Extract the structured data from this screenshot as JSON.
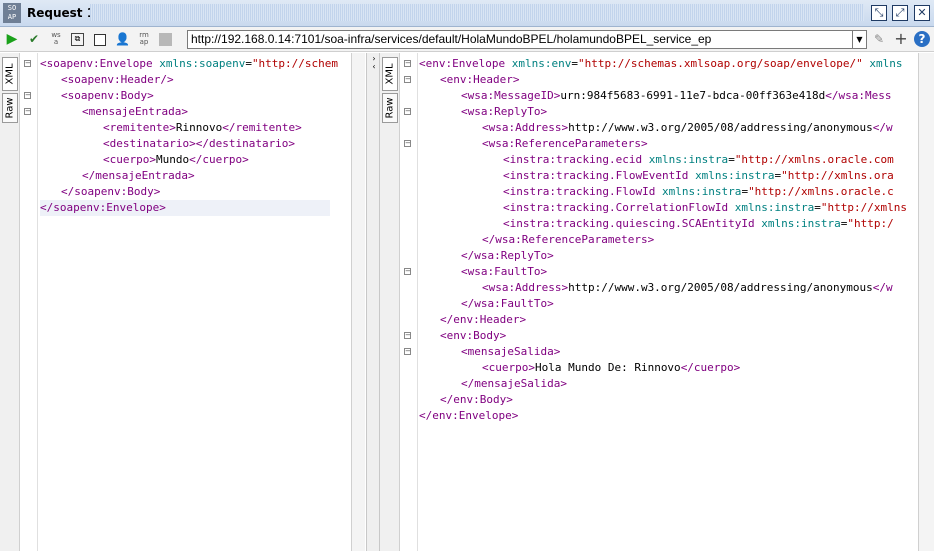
{
  "window": {
    "badge_top": "SO",
    "badge_bottom": "AP",
    "title": "Request 1",
    "controls": [
      "restore-icon",
      "maximize-icon",
      "close-icon"
    ]
  },
  "toolbar": {
    "url": "http://192.168.0.14:7101/soa-infra/services/default/HolaMundoBPEL/holamundoBPEL_service_ep",
    "icons": [
      "play-icon",
      "check-icon",
      "wsa-icon",
      "frame-icon",
      "checkbox-icon",
      "user-icon",
      "wsrm-icon",
      "stop-icon",
      "pin-icon",
      "plus-icon",
      "help-icon"
    ]
  },
  "request": {
    "tabs": [
      "XML",
      "Raw"
    ],
    "lines": [
      {
        "indent": 0,
        "fold": "-",
        "parts": [
          [
            "tag",
            "<soapenv:Envelope "
          ],
          [
            "attr",
            "xmlns:soapenv"
          ],
          [
            "txt",
            "="
          ],
          [
            "val",
            "\"http://schem"
          ]
        ]
      },
      {
        "indent": 1,
        "fold": "",
        "parts": [
          [
            "tag",
            "<soapenv:Header/>"
          ]
        ]
      },
      {
        "indent": 1,
        "fold": "-",
        "parts": [
          [
            "tag",
            "<soapenv:Body>"
          ]
        ]
      },
      {
        "indent": 2,
        "fold": "-",
        "parts": [
          [
            "tag",
            "<mensajeEntrada>"
          ]
        ]
      },
      {
        "indent": 3,
        "fold": "",
        "parts": [
          [
            "tag",
            "<remitente>"
          ],
          [
            "txt",
            "Rinnovo"
          ],
          [
            "tag",
            "</remitente>"
          ]
        ]
      },
      {
        "indent": 3,
        "fold": "",
        "parts": [
          [
            "tag",
            "<destinatario></destinatario>"
          ]
        ]
      },
      {
        "indent": 3,
        "fold": "",
        "parts": [
          [
            "tag",
            "<cuerpo>"
          ],
          [
            "txt",
            "Mundo"
          ],
          [
            "tag",
            "</cuerpo>"
          ]
        ]
      },
      {
        "indent": 2,
        "fold": "",
        "parts": [
          [
            "tag",
            "</mensajeEntrada>"
          ]
        ]
      },
      {
        "indent": 1,
        "fold": "",
        "parts": [
          [
            "tag",
            "</soapenv:Body>"
          ]
        ]
      },
      {
        "indent": 0,
        "fold": "",
        "parts": [
          [
            "tag",
            "</soapenv:Envelope>"
          ]
        ]
      }
    ]
  },
  "response": {
    "tabs": [
      "XML",
      "Raw"
    ],
    "lines": [
      {
        "indent": 0,
        "fold": "-",
        "parts": [
          [
            "tag",
            "<env:Envelope "
          ],
          [
            "attr",
            "xmlns:env"
          ],
          [
            "txt",
            "="
          ],
          [
            "val",
            "\"http://schemas.xmlsoap.org/soap/envelope/\""
          ],
          [
            "attr",
            " xmlns"
          ]
        ]
      },
      {
        "indent": 1,
        "fold": "-",
        "parts": [
          [
            "tag",
            "<env:Header>"
          ]
        ]
      },
      {
        "indent": 2,
        "fold": "",
        "parts": [
          [
            "tag",
            "<wsa:MessageID>"
          ],
          [
            "txt",
            "urn:984f5683-6991-11e7-bdca-00ff363e418d"
          ],
          [
            "tag",
            "</wsa:Mess"
          ]
        ]
      },
      {
        "indent": 2,
        "fold": "-",
        "parts": [
          [
            "tag",
            "<wsa:ReplyTo>"
          ]
        ]
      },
      {
        "indent": 3,
        "fold": "",
        "parts": [
          [
            "tag",
            "<wsa:Address>"
          ],
          [
            "txt",
            "http://www.w3.org/2005/08/addressing/anonymous"
          ],
          [
            "tag",
            "</w"
          ]
        ]
      },
      {
        "indent": 3,
        "fold": "-",
        "parts": [
          [
            "tag",
            "<wsa:ReferenceParameters>"
          ]
        ]
      },
      {
        "indent": 4,
        "fold": "",
        "parts": [
          [
            "tag",
            "<instra:tracking.ecid "
          ],
          [
            "attr",
            "xmlns:instra"
          ],
          [
            "txt",
            "="
          ],
          [
            "val",
            "\"http://xmlns.oracle.com"
          ]
        ]
      },
      {
        "indent": 4,
        "fold": "",
        "parts": [
          [
            "tag",
            "<instra:tracking.FlowEventId "
          ],
          [
            "attr",
            "xmlns:instra"
          ],
          [
            "txt",
            "="
          ],
          [
            "val",
            "\"http://xmlns.ora"
          ]
        ]
      },
      {
        "indent": 4,
        "fold": "",
        "parts": [
          [
            "tag",
            "<instra:tracking.FlowId "
          ],
          [
            "attr",
            "xmlns:instra"
          ],
          [
            "txt",
            "="
          ],
          [
            "val",
            "\"http://xmlns.oracle.c"
          ]
        ]
      },
      {
        "indent": 4,
        "fold": "",
        "parts": [
          [
            "tag",
            "<instra:tracking.CorrelationFlowId "
          ],
          [
            "attr",
            "xmlns:instra"
          ],
          [
            "txt",
            "="
          ],
          [
            "val",
            "\"http://xmlns"
          ]
        ]
      },
      {
        "indent": 4,
        "fold": "",
        "parts": [
          [
            "tag",
            "<instra:tracking.quiescing.SCAEntityId "
          ],
          [
            "attr",
            "xmlns:instra"
          ],
          [
            "txt",
            "="
          ],
          [
            "val",
            "\"http:/"
          ]
        ]
      },
      {
        "indent": 3,
        "fold": "",
        "parts": [
          [
            "tag",
            "</wsa:ReferenceParameters>"
          ]
        ]
      },
      {
        "indent": 2,
        "fold": "",
        "parts": [
          [
            "tag",
            "</wsa:ReplyTo>"
          ]
        ]
      },
      {
        "indent": 2,
        "fold": "-",
        "parts": [
          [
            "tag",
            "<wsa:FaultTo>"
          ]
        ]
      },
      {
        "indent": 3,
        "fold": "",
        "parts": [
          [
            "tag",
            "<wsa:Address>"
          ],
          [
            "txt",
            "http://www.w3.org/2005/08/addressing/anonymous"
          ],
          [
            "tag",
            "</w"
          ]
        ]
      },
      {
        "indent": 2,
        "fold": "",
        "parts": [
          [
            "tag",
            "</wsa:FaultTo>"
          ]
        ]
      },
      {
        "indent": 1,
        "fold": "",
        "parts": [
          [
            "tag",
            "</env:Header>"
          ]
        ]
      },
      {
        "indent": 1,
        "fold": "-",
        "parts": [
          [
            "tag",
            "<env:Body>"
          ]
        ]
      },
      {
        "indent": 2,
        "fold": "-",
        "parts": [
          [
            "tag",
            "<mensajeSalida>"
          ]
        ]
      },
      {
        "indent": 3,
        "fold": "",
        "parts": [
          [
            "tag",
            "<cuerpo>"
          ],
          [
            "txt",
            "Hola Mundo De: Rinnovo"
          ],
          [
            "tag",
            "</cuerpo>"
          ]
        ]
      },
      {
        "indent": 2,
        "fold": "",
        "parts": [
          [
            "tag",
            "</mensajeSalida>"
          ]
        ]
      },
      {
        "indent": 1,
        "fold": "",
        "parts": [
          [
            "tag",
            "</env:Body>"
          ]
        ]
      },
      {
        "indent": 0,
        "fold": "",
        "parts": [
          [
            "tag",
            "</env:Envelope>"
          ]
        ]
      }
    ]
  }
}
